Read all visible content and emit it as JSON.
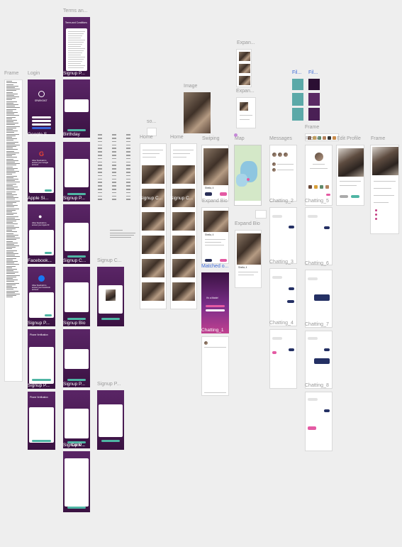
{
  "canvas": {
    "background": "#eeeeee"
  },
  "labels": {
    "frame": "Frame",
    "login": "Login",
    "terms": "Terms an...",
    "signup_p1": "Signup P...",
    "birthday": "Birthday",
    "signup_p2": "Signup P...",
    "signup_c1": "Signup C...",
    "signup_bio": "Signup Bio",
    "signup_p3": "Signup P...",
    "signup_c2": "Signup C...",
    "signup_p4": "Signup P...",
    "signup_p5": "Signup P...",
    "conv": "Conv...",
    "google_s": "Google S...",
    "apple_si": "Apple Si...",
    "facebook": "Facebook...",
    "signup_p6": "Signup P...",
    "signup_p7": "Signup P...",
    "image": "Image",
    "so": "so...",
    "home1": "Home",
    "home2": "Home",
    "signup_c3": "Signup C...",
    "signup_c4": "Signup C...",
    "swiping": "Swiping",
    "expand_bio1": "Expand Bio",
    "expand_bio2": "Expand Bio",
    "matched": "Matched o...",
    "chatting_1": "Chatting_1",
    "map": "Map",
    "expan_top": "Expan...",
    "expan_mid": "Expan...",
    "messages": "Messages",
    "chatting_2": "Chatting_2",
    "chatting_3": "Chatting_3",
    "chatting_4": "Chatting_4",
    "frame2": "Frame",
    "profile": "Profile",
    "edit_profile": "Edit Profile",
    "frame3": "Frame",
    "chatting_5": "Chatting_5",
    "chatting_6": "Chatting_6",
    "chatting_7": "Chatting_7",
    "chatting_8": "Chatting_8",
    "fil1": "Fil...",
    "fil2": "Fil..."
  },
  "screens": {
    "terms_title": "Terms and Conditions",
    "login_brand": "SPARKSKIT",
    "google_text": "Allow Sparkskit to access your Google account",
    "apple_text": "Allow Sparkskit to access your Apple ID",
    "facebook_text": "Allow Sparkskit to access your Facebook account",
    "phone_verification": "Phone Verification",
    "matched_title": "It's a Match!",
    "swipe_name": "Sheila, 4",
    "expand_name": "Sheila, 4"
  },
  "colors": {
    "purple": "#5a2566",
    "teal": "#4fb5a4",
    "pink": "#e45aa3",
    "navy": "#243064",
    "blue_label": "#3d6ad6"
  }
}
